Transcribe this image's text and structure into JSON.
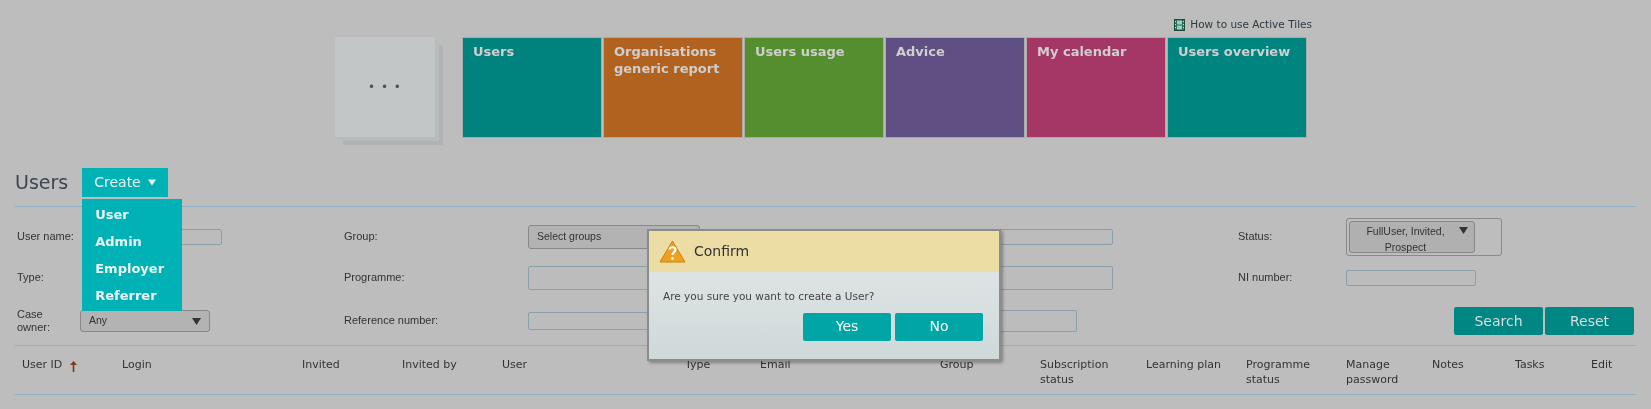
{
  "help_link": {
    "label": "How to use Active Tiles"
  },
  "more_tile": {
    "label": "• • •"
  },
  "tiles": [
    {
      "label": "Users",
      "color": "#00837f"
    },
    {
      "label": "Organisations generic report",
      "color": "#b0621e"
    },
    {
      "label": "Users usage",
      "color": "#548e2e"
    },
    {
      "label": "Advice",
      "color": "#604f82"
    },
    {
      "label": "My calendar",
      "color": "#a43765"
    },
    {
      "label": "Users overview",
      "color": "#00847f"
    }
  ],
  "section": {
    "title": "Users"
  },
  "create_menu": {
    "label": "Create",
    "expanded": true,
    "items": [
      "User",
      "Admin",
      "Employer",
      "Referrer"
    ]
  },
  "filter_rows": [
    [
      {
        "label": "User name:",
        "field": {
          "kind": "text"
        }
      },
      {
        "label": "Group:",
        "field": {
          "kind": "select",
          "value": "Select groups"
        }
      },
      {
        "field": {
          "kind": "text"
        }
      },
      {
        "label": "Status:",
        "field": {
          "kind": "multiselect",
          "value": "FullUser, Invited, Prospect"
        }
      }
    ],
    [
      {
        "label": "Type:"
      },
      {
        "label": "Programme:",
        "field": {
          "kind": "text"
        }
      },
      {
        "field": {
          "kind": "text"
        }
      },
      {
        "label": "NI number:",
        "field": {
          "kind": "text"
        }
      }
    ],
    [
      {
        "label": "Case owner:",
        "field": {
          "kind": "select",
          "value": "Any"
        }
      },
      {
        "label": "Reference number:",
        "field": {
          "kind": "text"
        }
      },
      {
        "field": {
          "kind": "text"
        }
      }
    ]
  ],
  "actions": [
    {
      "label": "Search"
    },
    {
      "label": "Reset"
    }
  ],
  "table": {
    "columns": [
      {
        "label": "User ID",
        "sorted": true
      },
      {
        "label": "Login",
        "sorted": false
      },
      {
        "label": "Invited",
        "sorted": false
      },
      {
        "label": "Invited by",
        "sorted": false
      },
      {
        "label": "User",
        "sorted": false
      },
      {
        "label": "Type",
        "sorted": false
      },
      {
        "label": "Email",
        "sorted": false
      },
      {
        "label": "Group",
        "sorted": false
      },
      {
        "label": "Subscription status",
        "sorted": false
      },
      {
        "label": "Learning plan",
        "sorted": false
      },
      {
        "label": "Programme status",
        "sorted": false
      },
      {
        "label": "Manage password",
        "sorted": false
      },
      {
        "label": "Notes",
        "sorted": false
      },
      {
        "label": "Tasks",
        "sorted": false
      },
      {
        "label": "Edit",
        "sorted": false
      }
    ]
  },
  "dialog": {
    "title": "Confirm",
    "message": "Are you sure you want to create a User?",
    "buttons": [
      "Yes",
      "No"
    ]
  }
}
